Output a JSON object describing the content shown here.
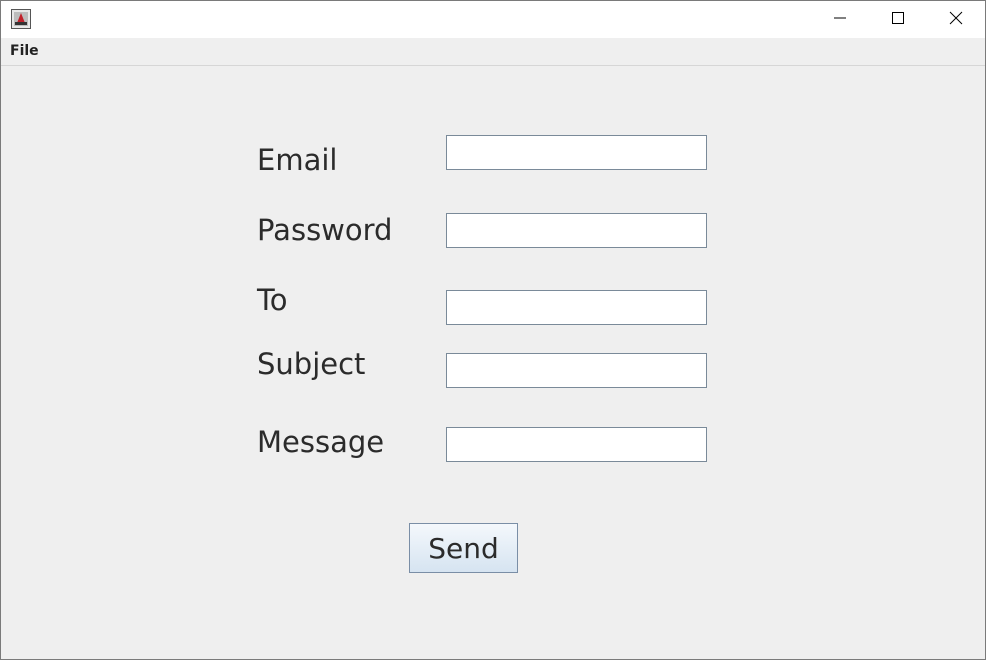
{
  "menu": {
    "file_label": "File"
  },
  "form": {
    "email_label": "Email",
    "password_label": "Password",
    "to_label": "To",
    "subject_label": "Subject",
    "message_label": "Message",
    "email_value": "",
    "password_value": "",
    "to_value": "",
    "subject_value": "",
    "message_value": "",
    "send_label": "Send"
  },
  "icons": {
    "app": "java-app-icon",
    "minimize": "minimize-icon",
    "maximize": "maximize-icon",
    "close": "close-icon"
  }
}
